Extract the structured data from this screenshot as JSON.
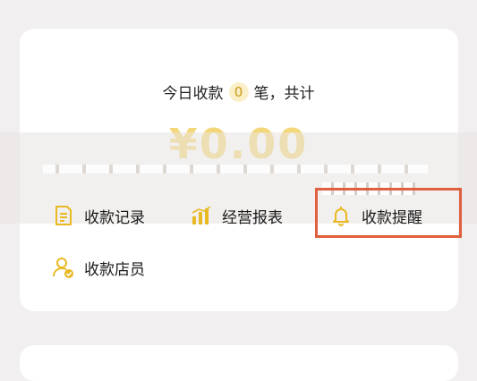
{
  "summary": {
    "prefix": "今日收款",
    "count": "0",
    "suffix": "笔，共计"
  },
  "amount": "¥0.00",
  "menu": [
    {
      "label": "收款记录",
      "icon": "receipt-icon"
    },
    {
      "label": "经营报表",
      "icon": "bar-chart-icon"
    },
    {
      "label": "收款提醒",
      "icon": "bell-icon"
    },
    {
      "label": "收款店员",
      "icon": "clerk-icon"
    }
  ],
  "colors": {
    "accent": "#e8b923",
    "highlight": "#e05f3e",
    "amount": "#f3d77a"
  }
}
